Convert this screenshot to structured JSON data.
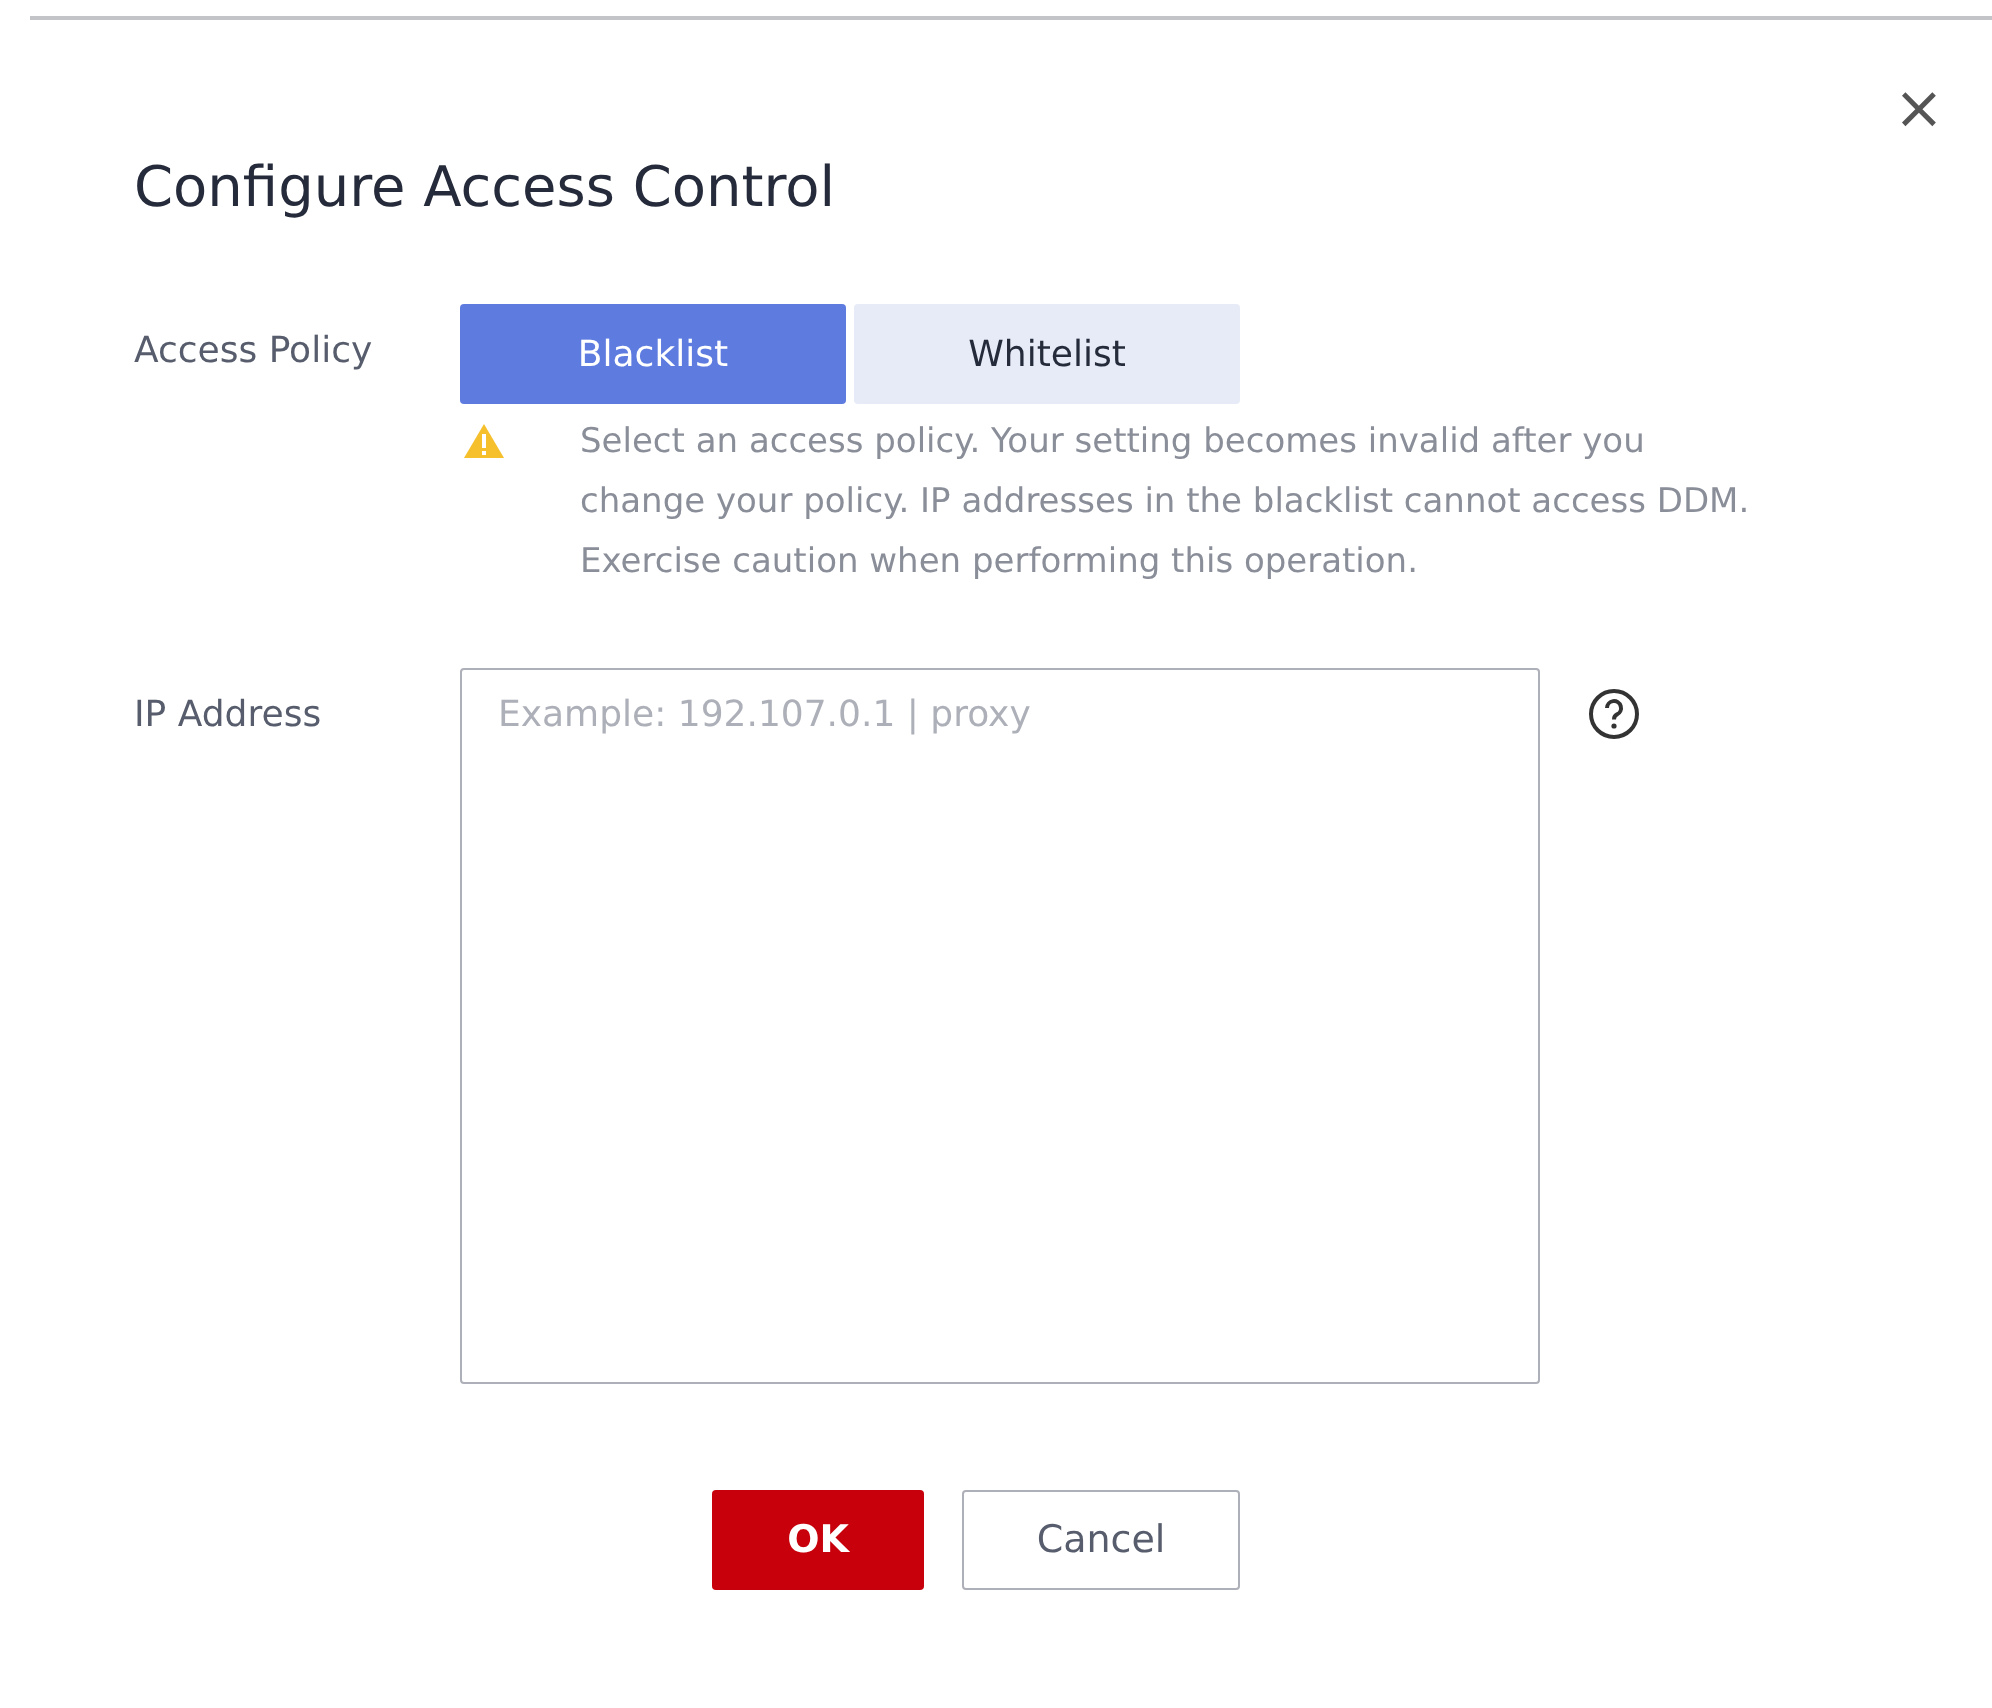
{
  "dialog": {
    "title": "Configure Access Control",
    "close": "×"
  },
  "access_policy": {
    "label": "Access Policy",
    "options": [
      {
        "label": "Blacklist",
        "selected": true
      },
      {
        "label": "Whitelist",
        "selected": false
      }
    ],
    "warning": "Select an access policy. Your setting becomes invalid after you change your policy. IP addresses in the blacklist cannot access DDM. Exercise caution when performing this operation."
  },
  "ip_address": {
    "label": "IP Address",
    "placeholder": "Example: 192.107.0.1 | proxy"
  },
  "buttons": [
    {
      "kind": "primary",
      "label": "OK"
    },
    {
      "kind": "secondary",
      "label": "Cancel"
    }
  ]
}
